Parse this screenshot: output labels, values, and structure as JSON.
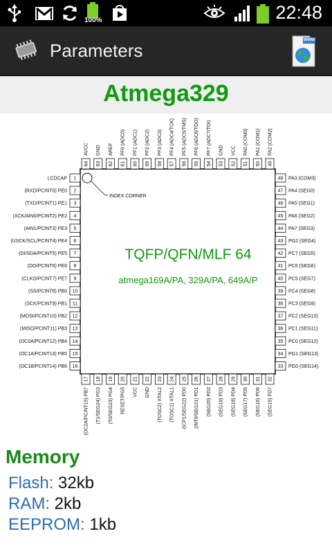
{
  "status_bar": {
    "time": "22:48",
    "battery_small_label": "100%"
  },
  "action_bar": {
    "title": "Parameters",
    "web_badge": "www"
  },
  "chip": {
    "name": "Atmega329",
    "package": "TQFP/QFN/MLF 64",
    "variants": "atmega169A/PA, 329A/PA, 649A/P",
    "index_corner_label": "INDEX CORNER",
    "pins_left": [
      {
        "n": "1",
        "label": "LCDCAP"
      },
      {
        "n": "2",
        "label": "(RXD/PCINT0) PE0"
      },
      {
        "n": "3",
        "label": "(TXD/PCINT1) PE1"
      },
      {
        "n": "4",
        "label": "(XCK/AIN0/PCINT2) PE2"
      },
      {
        "n": "5",
        "label": "(AIN1/PCINT3) PE3"
      },
      {
        "n": "6",
        "label": "(USCK/SCL/PCINT4) PE4"
      },
      {
        "n": "7",
        "label": "(DI/SDA/PCINT5) PE5"
      },
      {
        "n": "8",
        "label": "(DO/PCINT6) PE6"
      },
      {
        "n": "9",
        "label": "(CLKO/PCINT7) PE7"
      },
      {
        "n": "10",
        "label": "(SS/PCINT8) PB0"
      },
      {
        "n": "11",
        "label": "(SCK/PCINT9) PB1"
      },
      {
        "n": "12",
        "label": "(MOSI/PCINT10) PB2"
      },
      {
        "n": "13",
        "label": "(MISO/PCINT11) PB3"
      },
      {
        "n": "14",
        "label": "(OC0A/PCINT12) PB4"
      },
      {
        "n": "15",
        "label": "(OC1A/PCINT13) PB5"
      },
      {
        "n": "16",
        "label": "(OC1B/PCINT14) PB6"
      }
    ],
    "pins_right": [
      {
        "n": "48",
        "label": "PA3 (COM3)"
      },
      {
        "n": "47",
        "label": "PA4 (SEG0)"
      },
      {
        "n": "46",
        "label": "PA5 (SEG1)"
      },
      {
        "n": "45",
        "label": "PA6 (SEG2)"
      },
      {
        "n": "44",
        "label": "PA7 (SEG3)"
      },
      {
        "n": "43",
        "label": "PG2 (SEG4)"
      },
      {
        "n": "42",
        "label": "PC7 (SEG5)"
      },
      {
        "n": "41",
        "label": "PC6 (SEG6)"
      },
      {
        "n": "40",
        "label": "PC5 (SEG7)"
      },
      {
        "n": "39",
        "label": "PC4 (SEG8)"
      },
      {
        "n": "38",
        "label": "PC3 (SEG9)"
      },
      {
        "n": "37",
        "label": "PC2 (SEG10)"
      },
      {
        "n": "36",
        "label": "PC1 (SEG11)"
      },
      {
        "n": "35",
        "label": "PC0 (SEG12)"
      },
      {
        "n": "34",
        "label": "PG1 (SEG13)"
      },
      {
        "n": "33",
        "label": "PG0 (SEG14)"
      }
    ],
    "pins_top": [
      {
        "n": "64",
        "label": "AVCC"
      },
      {
        "n": "63",
        "label": "GND"
      },
      {
        "n": "62",
        "label": "AREF"
      },
      {
        "n": "61",
        "label": "PF0 (ADC0)"
      },
      {
        "n": "60",
        "label": "PF1 (ADC1)"
      },
      {
        "n": "59",
        "label": "PF2 (ADC2)"
      },
      {
        "n": "58",
        "label": "PF3 (ADC3)"
      },
      {
        "n": "57",
        "label": "PF4 (ADC4/TCK)"
      },
      {
        "n": "56",
        "label": "PF5 (ADC5/TMS)"
      },
      {
        "n": "55",
        "label": "PF6 (ADC6/TDO)"
      },
      {
        "n": "54",
        "label": "PF7 (ADC7/TDI)"
      },
      {
        "n": "53",
        "label": "GND"
      },
      {
        "n": "52",
        "label": "VCC"
      },
      {
        "n": "51",
        "label": "PA0 (COM0)"
      },
      {
        "n": "50",
        "label": "PA1 (COM1)"
      },
      {
        "n": "49",
        "label": "PA2 (COM2)"
      }
    ],
    "pins_bottom": [
      {
        "n": "17",
        "label": "(OC2A/PCINT15) PB7"
      },
      {
        "n": "18",
        "label": "(T1/SEG24) PG3"
      },
      {
        "n": "19",
        "label": "(T0/SEG23) PG4"
      },
      {
        "n": "20",
        "label": "RESET/PG5"
      },
      {
        "n": "21",
        "label": "VCC"
      },
      {
        "n": "22",
        "label": "GND"
      },
      {
        "n": "23",
        "label": "(TOSC2) XTAL2"
      },
      {
        "n": "24",
        "label": "(TOSC1) XTAL1"
      },
      {
        "n": "25",
        "label": "(ICP1/SEG22) PD0"
      },
      {
        "n": "26",
        "label": "(INT0/SEG21) PD1"
      },
      {
        "n": "27",
        "label": "(SEG20) PD2"
      },
      {
        "n": "28",
        "label": "(SEG19) PD3"
      },
      {
        "n": "29",
        "label": "(SEG18) PD4"
      },
      {
        "n": "30",
        "label": "(SEG17) PD5"
      },
      {
        "n": "31",
        "label": "(SEG16) PD6"
      },
      {
        "n": "32",
        "label": "(SEG15) PD7"
      }
    ]
  },
  "memory": {
    "title": "Memory",
    "items": [
      {
        "key": "Flash:",
        "value": "32kb"
      },
      {
        "key": "RAM:",
        "value": "2kb"
      },
      {
        "key": "EEPROM:",
        "value": "1kb"
      }
    ]
  },
  "colors": {
    "accent_green": "#119911",
    "memory_key_blue": "#2a6fb0",
    "action_bar_bg": "#262626",
    "battery_green": "#7ccd2a"
  },
  "icons": {
    "status_left": [
      "usb-icon",
      "gmail-icon",
      "sync-icon",
      "battery-small-icon",
      "play-store-icon"
    ],
    "status_right": [
      "eye-icon",
      "signal-icon",
      "battery-icon"
    ],
    "action_left": "chip-icon",
    "action_right": "web-globe-icon"
  }
}
